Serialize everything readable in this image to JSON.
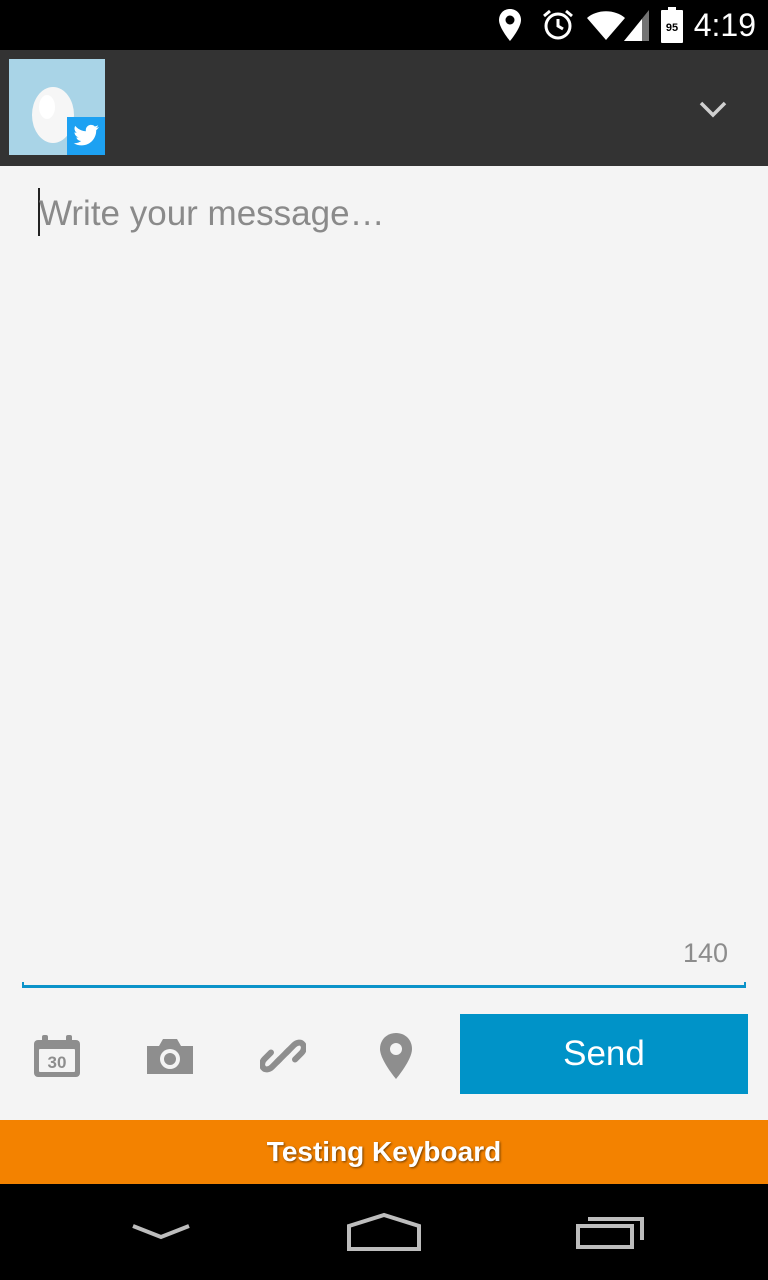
{
  "status_bar": {
    "time": "4:19",
    "battery_level": "95",
    "icons": [
      "location-icon",
      "alarm-icon",
      "wifi-icon",
      "signal-icon",
      "battery-icon"
    ]
  },
  "header": {
    "account_avatar": "egg-avatar",
    "account_service_icon": "twitter-icon",
    "dropdown_icon": "chevron-down-icon"
  },
  "compose": {
    "placeholder": "Write your message…",
    "value": "",
    "char_remaining": "140"
  },
  "toolbar": {
    "icons": [
      "calendar-icon",
      "camera-icon",
      "link-icon",
      "location-pin-icon"
    ],
    "calendar_day": "30",
    "send_label": "Send"
  },
  "keyboard_notice": {
    "label": "Testing Keyboard"
  },
  "nav_bar": {
    "icons": [
      "back-icon",
      "home-icon",
      "recents-icon"
    ]
  },
  "colors": {
    "accent": "#0093c8",
    "banner": "#f38200",
    "action_bar": "#333333",
    "status_bar": "#000000"
  }
}
